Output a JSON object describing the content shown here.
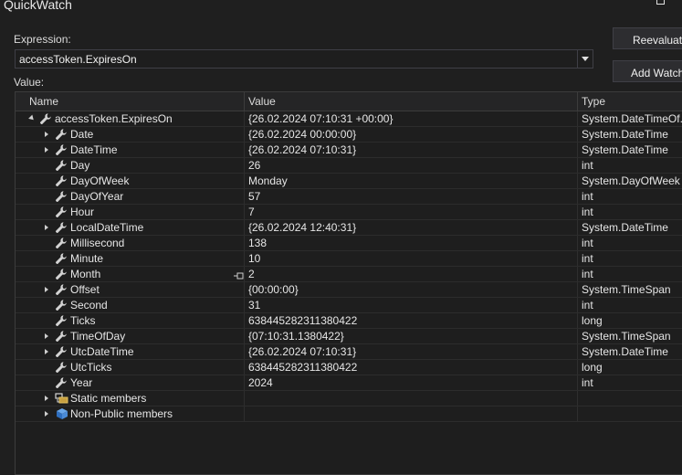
{
  "window": {
    "title": "QuickWatch"
  },
  "expression": {
    "label": "Expression:",
    "value": "accessToken.ExpiresOn"
  },
  "buttons": {
    "reevaluate": "Reevaluate",
    "add_watch": "Add Watch"
  },
  "value_label": "Value:",
  "columns": {
    "name": "Name",
    "value": "Value",
    "type": "Type"
  },
  "rows": [
    {
      "name": "accessToken.ExpiresOn",
      "value": "{26.02.2024 07:10:31 +00:00}",
      "type": "System.DateTimeOf..."
    },
    {
      "name": "Date",
      "value": "{26.02.2024 00:00:00}",
      "type": "System.DateTime"
    },
    {
      "name": "DateTime",
      "value": "{26.02.2024 07:10:31}",
      "type": "System.DateTime"
    },
    {
      "name": "Day",
      "value": "26",
      "type": "int"
    },
    {
      "name": "DayOfWeek",
      "value": "Monday",
      "type": "System.DayOfWeek"
    },
    {
      "name": "DayOfYear",
      "value": "57",
      "type": "int"
    },
    {
      "name": "Hour",
      "value": "7",
      "type": "int"
    },
    {
      "name": "LocalDateTime",
      "value": "{26.02.2024 12:40:31}",
      "type": "System.DateTime"
    },
    {
      "name": "Millisecond",
      "value": "138",
      "type": "int"
    },
    {
      "name": "Minute",
      "value": "10",
      "type": "int"
    },
    {
      "name": "Month",
      "value": "2",
      "type": "int"
    },
    {
      "name": "Offset",
      "value": "{00:00:00}",
      "type": "System.TimeSpan"
    },
    {
      "name": "Second",
      "value": "31",
      "type": "int"
    },
    {
      "name": "Ticks",
      "value": "638445282311380422",
      "type": "long"
    },
    {
      "name": "TimeOfDay",
      "value": "{07:10:31.1380422}",
      "type": "System.TimeSpan"
    },
    {
      "name": "UtcDateTime",
      "value": "{26.02.2024 07:10:31}",
      "type": "System.DateTime"
    },
    {
      "name": "UtcTicks",
      "value": "638445282311380422",
      "type": "long"
    },
    {
      "name": "Year",
      "value": "2024",
      "type": "int"
    },
    {
      "name": "Static members",
      "value": "",
      "type": ""
    },
    {
      "name": "Non-Public members",
      "value": "",
      "type": ""
    }
  ]
}
